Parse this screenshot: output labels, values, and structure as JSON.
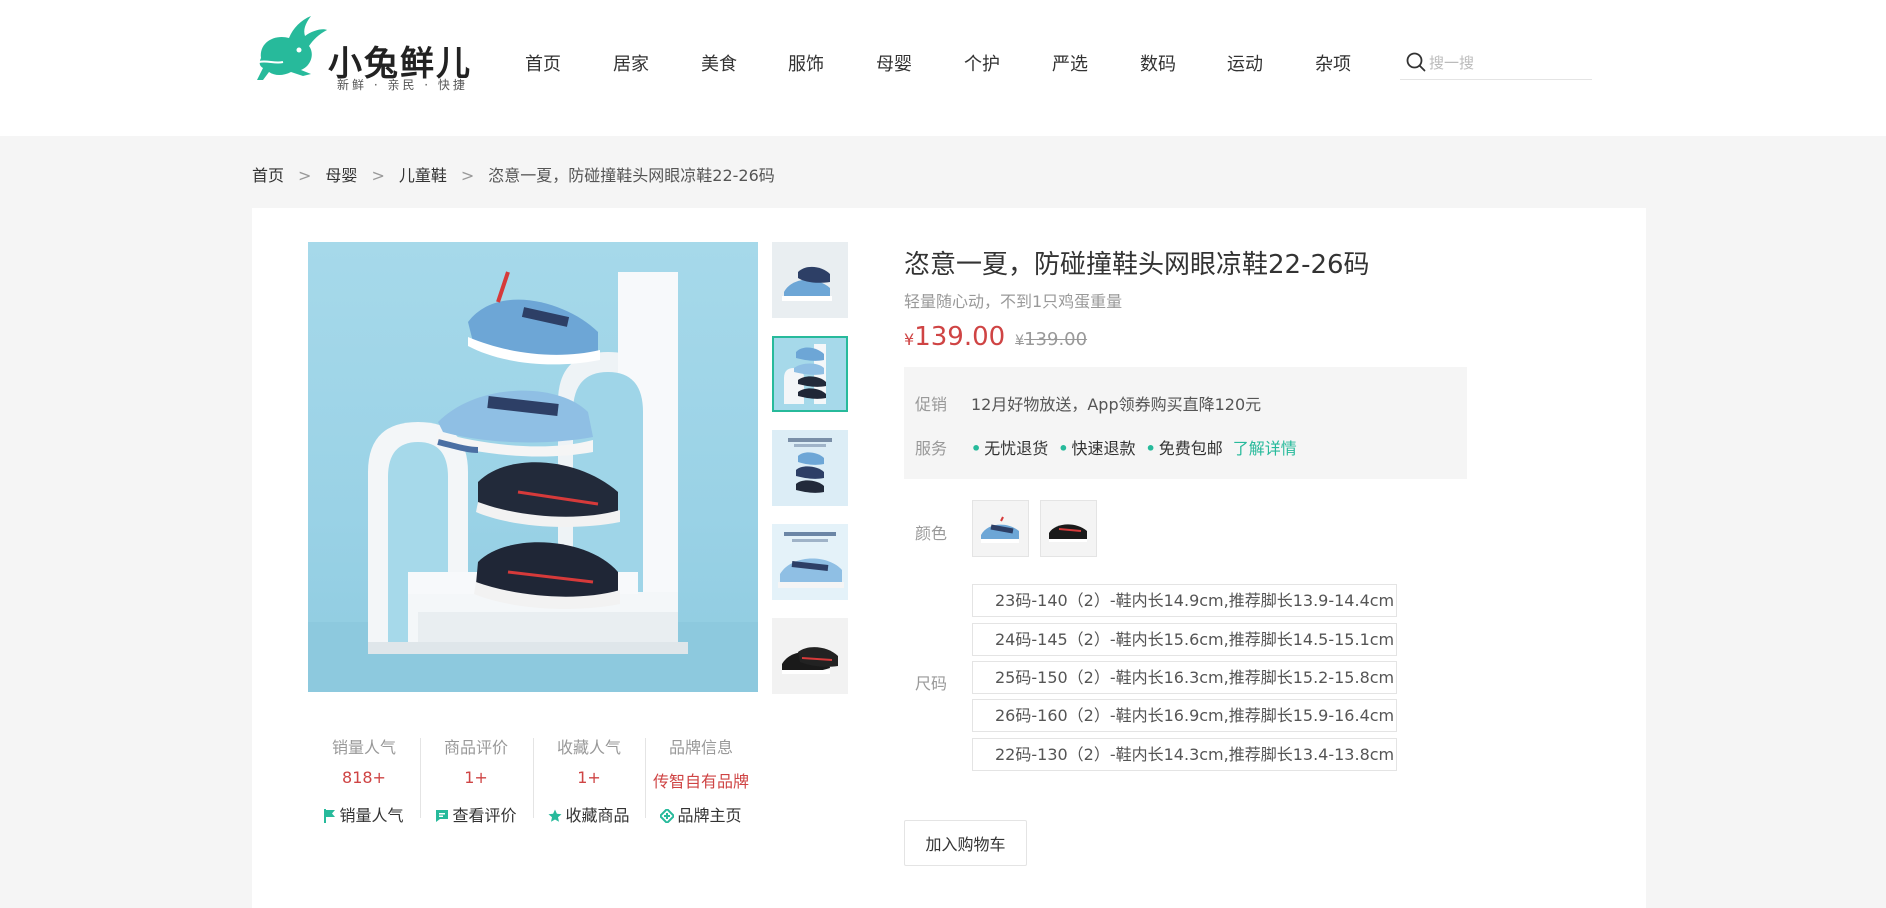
{
  "brand": {
    "title": "小兔鲜儿",
    "slogan": "新鲜 · 亲民 · 快捷",
    "accent": "#27ba9b"
  },
  "nav": {
    "items": [
      "首页",
      "居家",
      "美食",
      "服饰",
      "母婴",
      "个护",
      "严选",
      "数码",
      "运动",
      "杂项"
    ]
  },
  "search": {
    "placeholder": "搜一搜",
    "icon": "search-icon"
  },
  "breadcrumb": {
    "items": [
      "首页",
      "母婴",
      "儿童鞋"
    ],
    "separator": ">",
    "current": "恣意一夏，防碰撞鞋头网眼凉鞋22-26码"
  },
  "product": {
    "name": "恣意一夏，防碰撞鞋头网眼凉鞋22-26码",
    "desc": "轻量随心动，不到1只鸡蛋重量",
    "currency": "¥",
    "price": "139.00",
    "old_price": "139.00",
    "price_color": "#cf4444"
  },
  "promo": {
    "label": "促销",
    "text": "12月好物放送，App领券购买直降120元"
  },
  "service": {
    "label": "服务",
    "items": [
      "无忧退货",
      "快速退款",
      "免费包邮"
    ],
    "more": "了解详情"
  },
  "sku": {
    "color_label": "颜色",
    "colors": [
      "blue",
      "black"
    ],
    "size_label": "尺码",
    "sizes": [
      "23码-140（2）-鞋内长14.9cm,推荐脚长13.9-14.4cm",
      "24码-145（2）-鞋内长15.6cm,推荐脚长14.5-15.1cm",
      "25码-150（2）-鞋内长16.3cm,推荐脚长15.2-15.8cm",
      "26码-160（2）-鞋内长16.9cm,推荐脚长15.9-16.4cm",
      "22码-130（2）-鞋内长14.3cm,推荐脚长13.4-13.8cm"
    ]
  },
  "cart": {
    "label": "加入购物车"
  },
  "stats": [
    {
      "title": "销量人气",
      "value": "818+",
      "link": "销量人气",
      "icon": "flag-icon"
    },
    {
      "title": "商品评价",
      "value": "1+",
      "link": "查看评价",
      "icon": "comment-icon"
    },
    {
      "title": "收藏人气",
      "value": "1+",
      "link": "收藏商品",
      "icon": "star-icon"
    },
    {
      "title": "品牌信息",
      "value": "传智自有品牌",
      "link": "品牌主页",
      "icon": "brand-icon"
    }
  ],
  "gallery": {
    "active_thumb": 1,
    "thumb_count": 5
  }
}
